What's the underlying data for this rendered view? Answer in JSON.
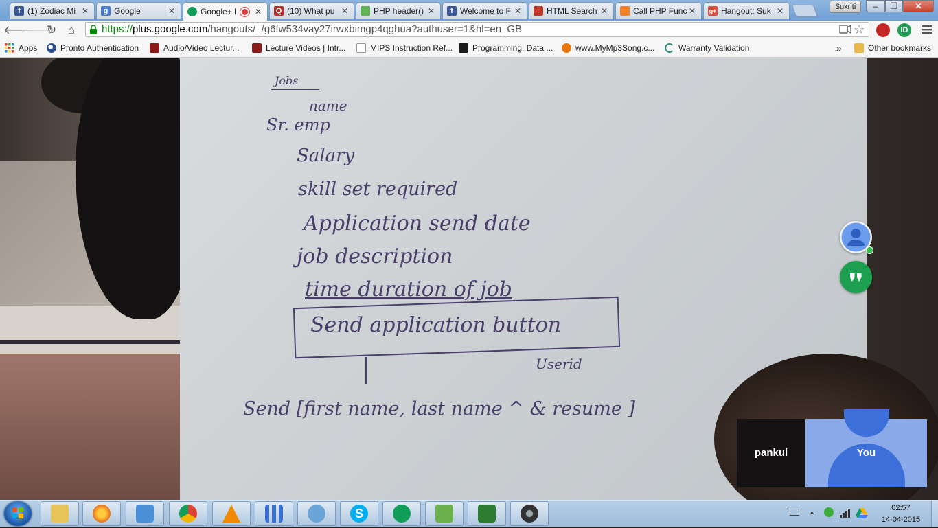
{
  "browser": {
    "tabs": [
      {
        "title": "(1) Zodiac Mi",
        "favicon": "facebook-favicon",
        "color": "#3b5998",
        "active": false
      },
      {
        "title": "Google",
        "favicon": "google-favicon",
        "color": "#4a7cd1",
        "active": false
      },
      {
        "title": "Google+ H",
        "favicon": "hangouts-favicon",
        "color": "#0f9d58",
        "active": true,
        "recording": true
      },
      {
        "title": "(10) What pu",
        "favicon": "quora-favicon",
        "color": "#b92b27",
        "active": false
      },
      {
        "title": "PHP header()",
        "favicon": "php-favicon",
        "color": "#62b35a",
        "active": false
      },
      {
        "title": "Welcome to F",
        "favicon": "facebook-favicon",
        "color": "#3b5998",
        "active": false
      },
      {
        "title": "HTML Search",
        "favicon": "w3schools-favicon",
        "color": "#c0392b",
        "active": false
      },
      {
        "title": "Call PHP Func",
        "favicon": "stackoverflow-favicon",
        "color": "#f48024",
        "active": false
      },
      {
        "title": "Hangout: Suk",
        "favicon": "googleplus-favicon",
        "color": "#dd4b39",
        "active": false
      }
    ],
    "profile_name": "Sukriti",
    "url": {
      "scheme": "https://",
      "host": "plus.google.com",
      "path": "/hangouts/_/g6fw534vay27irwxbimgp4qghua?authuser=1&hl=en_GB"
    },
    "bookmarks": [
      {
        "label": "Apps",
        "icon": "apps-grid-icon"
      },
      {
        "label": "Pronto Authentication",
        "icon": "search-icon"
      },
      {
        "label": "Audio/Video Lectur...",
        "icon": "mit-ocw-icon"
      },
      {
        "label": "Lecture Videos | Intr...",
        "icon": "mit-ocw-icon"
      },
      {
        "label": "MIPS Instruction Ref...",
        "icon": "page-icon"
      },
      {
        "label": "Programming, Data ...",
        "icon": "coursera-icon"
      },
      {
        "label": "www.MyMp3Song.c...",
        "icon": "music-icon"
      },
      {
        "label": "Warranty Validation",
        "icon": "loading-icon"
      }
    ],
    "bookmarks_overflow": "»",
    "other_bookmarks": "Other bookmarks"
  },
  "hangout": {
    "handwritten_note": {
      "heading": "Jobs",
      "lines": [
        "name",
        "Sr. emp",
        "Salary",
        "skill set required",
        "Application send date",
        "job description",
        "time duration of job",
        "Send application button",
        "Userid",
        "Send [first name, last name ^ & resume ]"
      ]
    },
    "participants": [
      {
        "name": "pankul"
      },
      {
        "name": "You"
      }
    ]
  },
  "taskbar": {
    "items": [
      {
        "name": "explorer",
        "icon": "folder-icon",
        "color": "#e8c35a"
      },
      {
        "name": "firefox",
        "icon": "firefox-icon",
        "color": "#e6701c"
      },
      {
        "name": "media",
        "icon": "media-player-icon",
        "color": "#4a90d9"
      },
      {
        "name": "chrome",
        "icon": "chrome-icon",
        "color": "#db4437"
      },
      {
        "name": "vlc",
        "icon": "vlc-icon",
        "color": "#f08a00"
      },
      {
        "name": "apps",
        "icon": "apps-grid-icon",
        "color": "#3b6fd1"
      },
      {
        "name": "paint",
        "icon": "paint-icon",
        "color": "#6aa5d8"
      },
      {
        "name": "skype",
        "icon": "skype-icon",
        "color": "#00aff0"
      },
      {
        "name": "hangouts",
        "icon": "hangouts-icon",
        "color": "#0f9d58"
      },
      {
        "name": "notepad",
        "icon": "notepad-icon",
        "color": "#6ab04c"
      },
      {
        "name": "task-manager",
        "icon": "task-manager-icon",
        "color": "#2e7d32"
      },
      {
        "name": "camera",
        "icon": "camera-icon",
        "color": "#333333"
      }
    ],
    "clock": {
      "time": "02:57",
      "date": "14-04-2015"
    }
  }
}
